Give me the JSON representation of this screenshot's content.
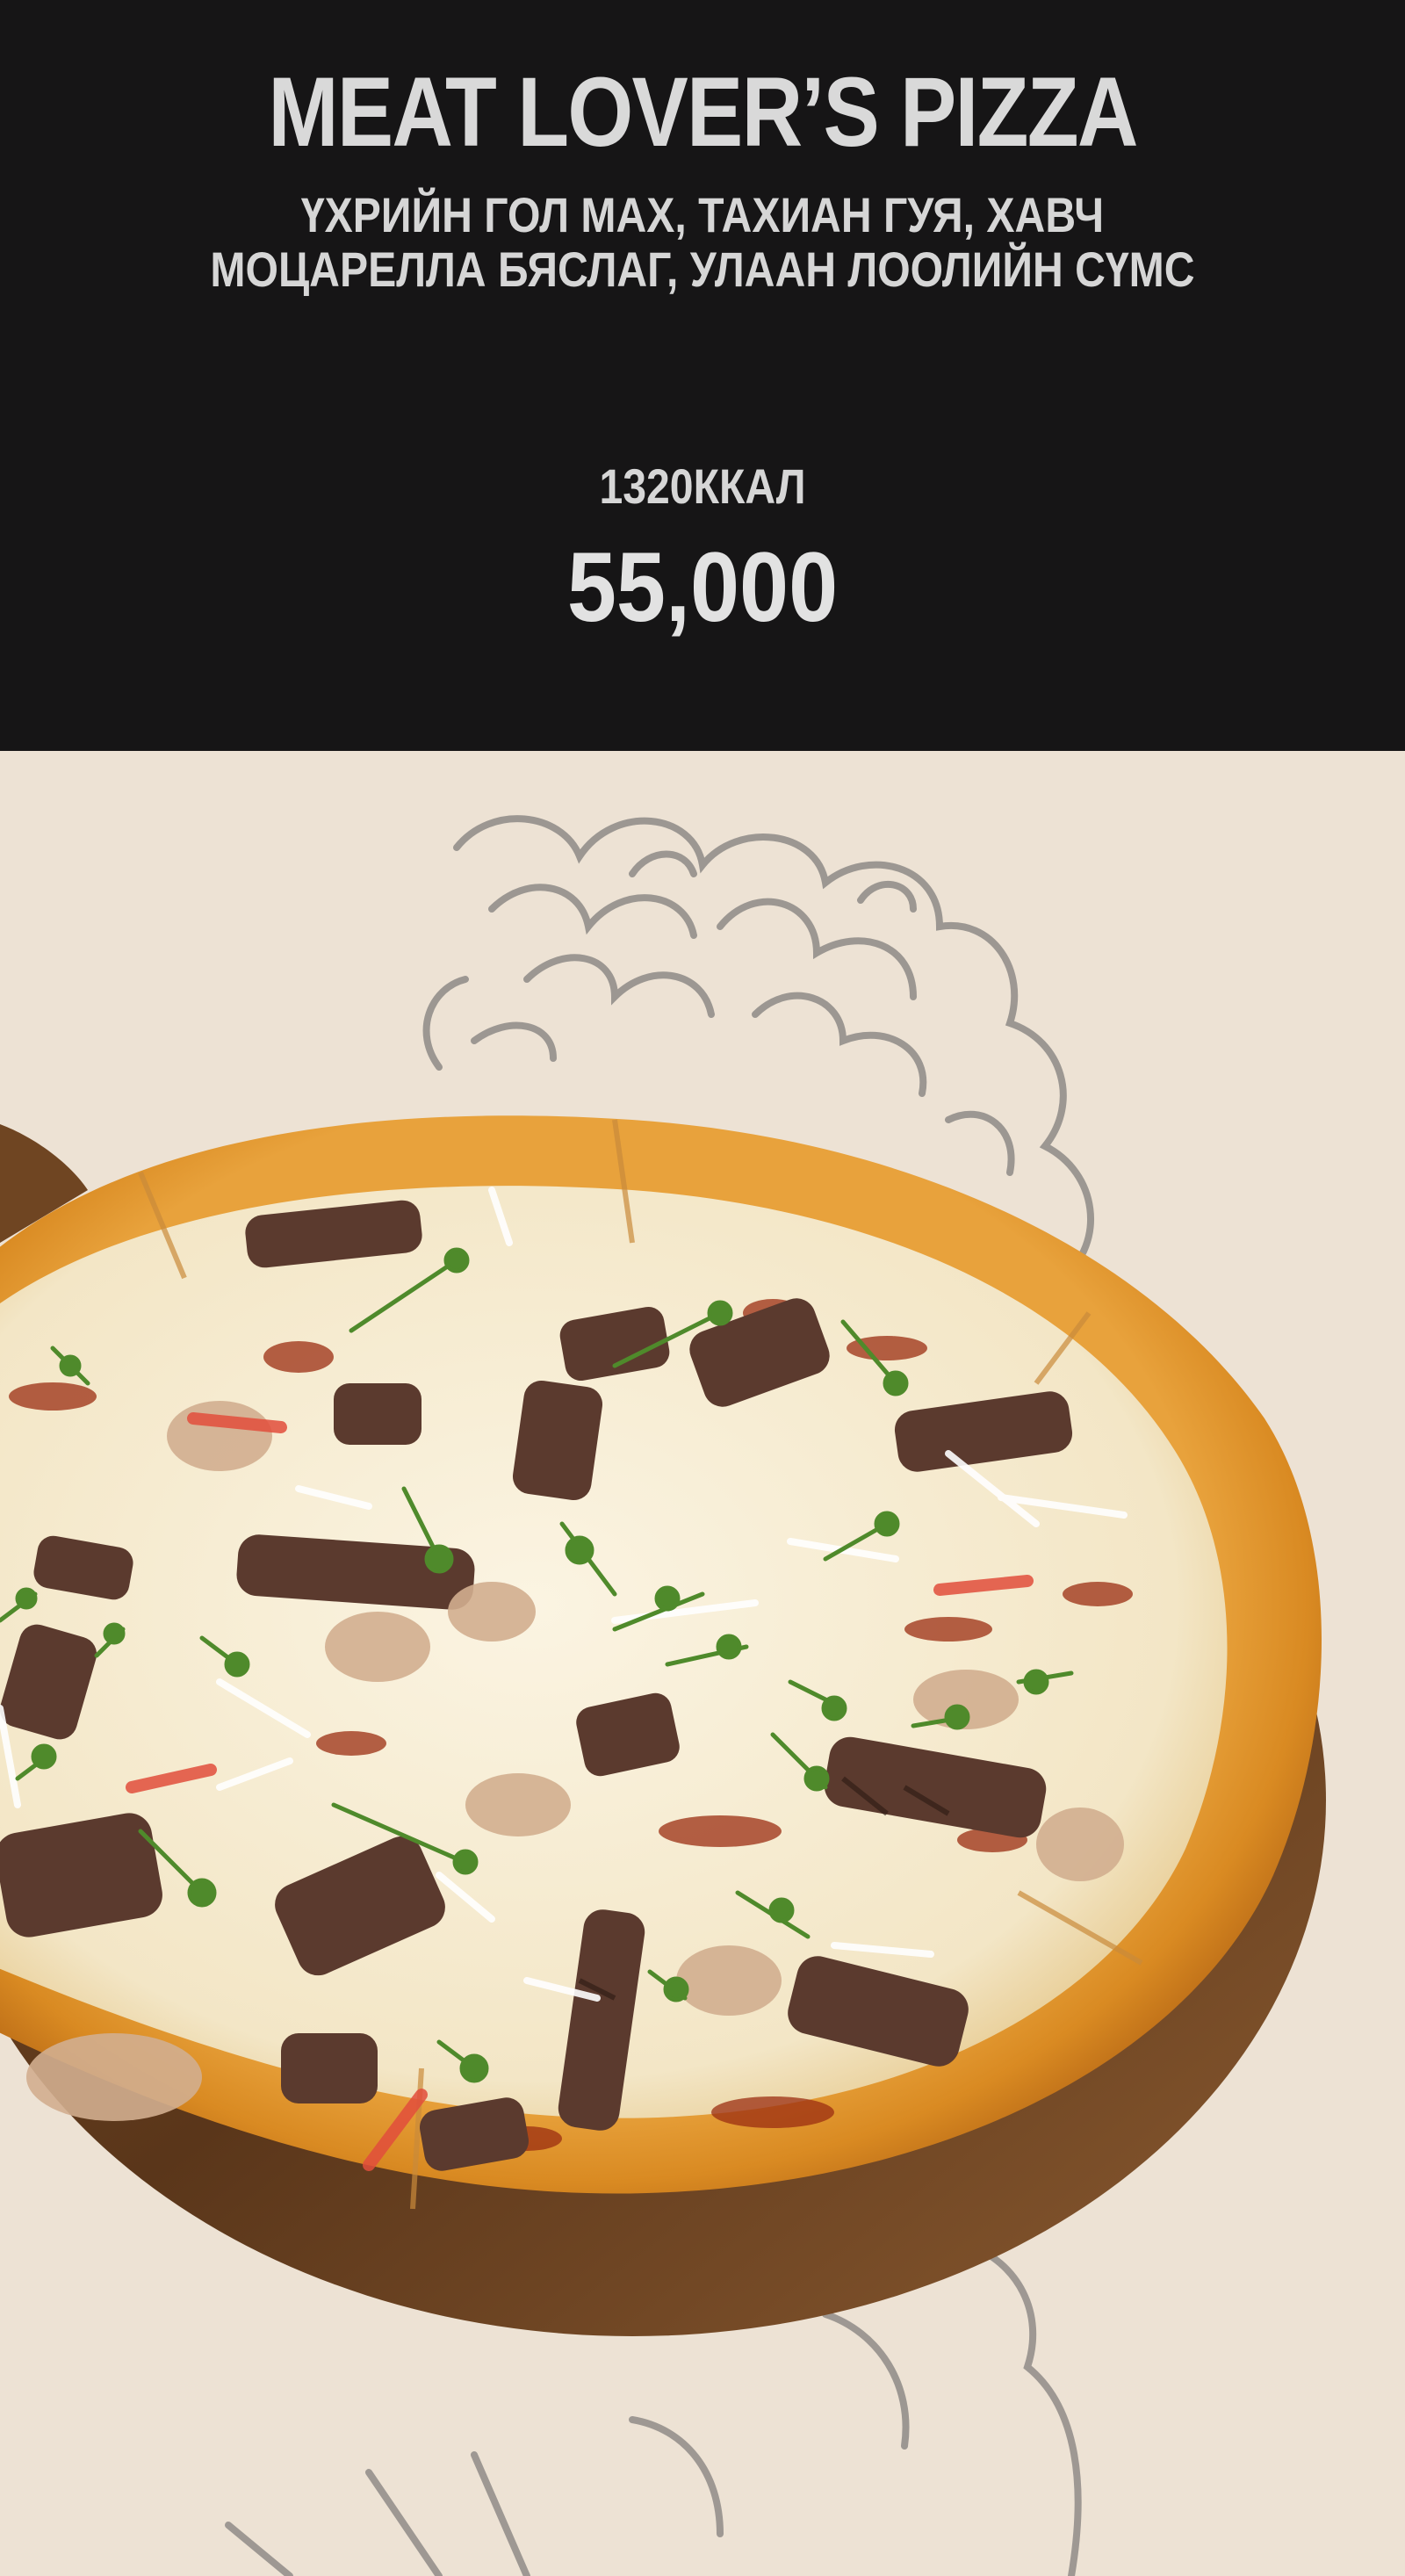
{
  "menu_item": {
    "title": "MEAT LOVER’S PIZZA",
    "ingredients_line1": "ҮХРИЙН ГОЛ МАХ, ТАХИАН ГУЯ, ХАВЧ",
    "ingredients_line2": "МОЦАРЕЛЛА БЯСЛАГ, УЛААН ЛООЛИЙН СҮМС",
    "calories": "1320ККАЛ",
    "price": "55,000"
  },
  "colors": {
    "header_background": "#161516",
    "header_text": "#d6d6d6",
    "photo_background": "#ede2d4",
    "crust": "#d9952f",
    "cheese": "#f5ecd7",
    "beef": "#5b3a2e",
    "herb": "#4f8a2b",
    "board": "#6a4322",
    "sketch": "#8f8b87"
  },
  "icons": {
    "pizza_photo": "meat-lovers-pizza-photo",
    "decorative_sketch": "statue-hair-sketch"
  }
}
